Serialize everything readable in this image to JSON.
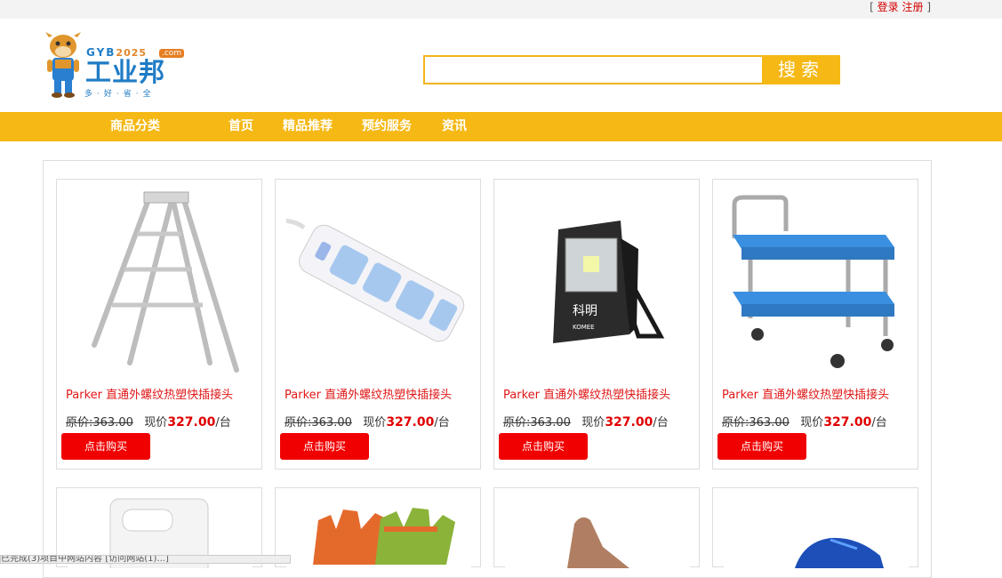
{
  "topbar": {
    "bracket_open": "[ ",
    "login": "登录",
    "register": "注册",
    "bracket_close": " ]"
  },
  "logo": {
    "letters": "GYB",
    "year": "2025",
    "com": ".com",
    "name": "工业邦",
    "tagline": "多·好·省·全"
  },
  "search": {
    "value": "",
    "placeholder": "",
    "button": "搜索"
  },
  "nav": {
    "category": "商品分类",
    "items": [
      "首页",
      "精品推荐",
      "预约服务",
      "资讯"
    ]
  },
  "products": [
    {
      "title": "Parker 直通外螺纹热塑快插接头",
      "old_label": "原价:",
      "old_price": "363.00",
      "now_label": "现价",
      "now_price": "327.00",
      "unit": "/台",
      "buy": "点击购买",
      "icon": "step-ladder"
    },
    {
      "title": "Parker 直通外螺纹热塑快插接头",
      "old_label": "原价:",
      "old_price": "363.00",
      "now_label": "现价",
      "now_price": "327.00",
      "unit": "/台",
      "buy": "点击购买",
      "icon": "power-strip"
    },
    {
      "title": "Parker 直通外螺纹热塑快插接头",
      "old_label": "原价:",
      "old_price": "363.00",
      "now_label": "现价",
      "now_price": "327.00",
      "unit": "/台",
      "buy": "点击购买",
      "icon": "flood-light"
    },
    {
      "title": "Parker 直通外螺纹热塑快插接头",
      "old_label": "原价:",
      "old_price": "363.00",
      "now_label": "现价",
      "now_price": "327.00",
      "unit": "/台",
      "buy": "点击购买",
      "icon": "hand-cart"
    }
  ],
  "products_row2": [
    {
      "icon": "plastic-jug"
    },
    {
      "icon": "work-gloves"
    },
    {
      "icon": "safety-boot"
    },
    {
      "icon": "sneaker"
    }
  ],
  "flood_light_brand": "科明",
  "flood_light_brand_en": "KOMEE",
  "status_text": "已完成(3)项目中网站内容 [访问网站(1)...]"
}
